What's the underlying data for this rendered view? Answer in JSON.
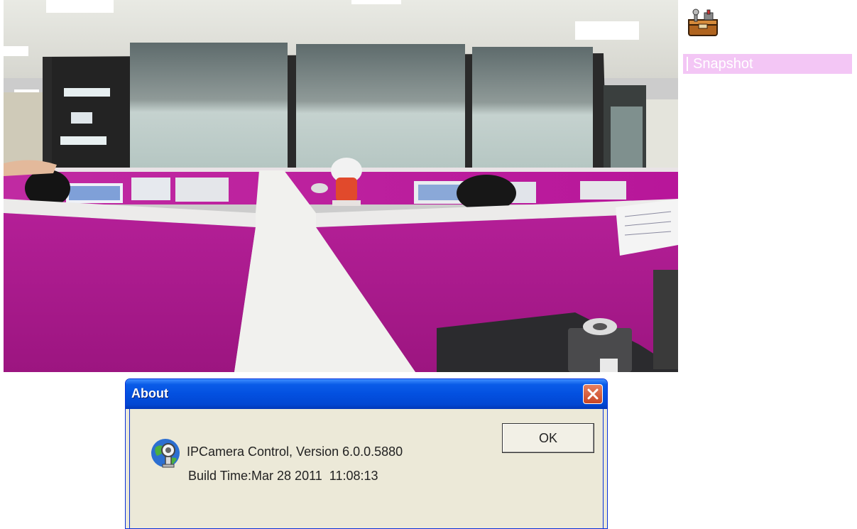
{
  "sidebar": {
    "toolbox_icon": "toolbox-icon",
    "snapshot_label": "Snapshot",
    "snapshot_bg": "#f3c6f5"
  },
  "camera": {
    "icon_semantics": [
      "office-scene",
      "cubicle-partitions",
      "doll",
      "monitors"
    ]
  },
  "about_dialog": {
    "title": "About",
    "version_line": "IPCamera Control, Version 6.0.0.5880",
    "build_line": "Build Time:Mar 28 2011  11:08:13",
    "ok_label": "OK",
    "close_icon": "close-icon",
    "app_icon": "globe-camera-icon",
    "title_bar_color": "#0350e0",
    "body_color": "#ece9d8"
  }
}
